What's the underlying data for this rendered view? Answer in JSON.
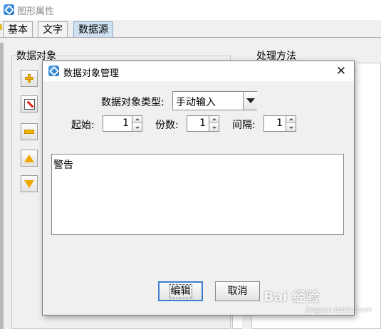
{
  "background_window": {
    "title": "图形属性",
    "tabs": [
      {
        "label": "基本"
      },
      {
        "label": "文字"
      },
      {
        "label": "数据源",
        "active": true
      }
    ],
    "left_section_label": "数据对象",
    "right_section_label": "处理方法",
    "side_buttons": [
      "add-icon",
      "edit-icon",
      "remove-icon",
      "move-up-icon",
      "move-down-icon"
    ]
  },
  "dialog": {
    "title": "数据对象管理",
    "type_label": "数据对象类型:",
    "type_value": "手动输入",
    "start_label": "起始:",
    "start_value": "1",
    "copies_label": "份数:",
    "copies_value": "1",
    "interval_label": "间隔:",
    "interval_value": "1",
    "content": "警告",
    "edit_button": "编辑",
    "cancel_button": "取消",
    "close_symbol": "✕"
  },
  "watermark": {
    "text": "Bai 经验",
    "sub": "jingyan.baidu.com"
  },
  "colors": {
    "active_tab": "#cfe0f1",
    "focus_border": "#3c7fd1",
    "icon_accent": "#f0b400"
  }
}
